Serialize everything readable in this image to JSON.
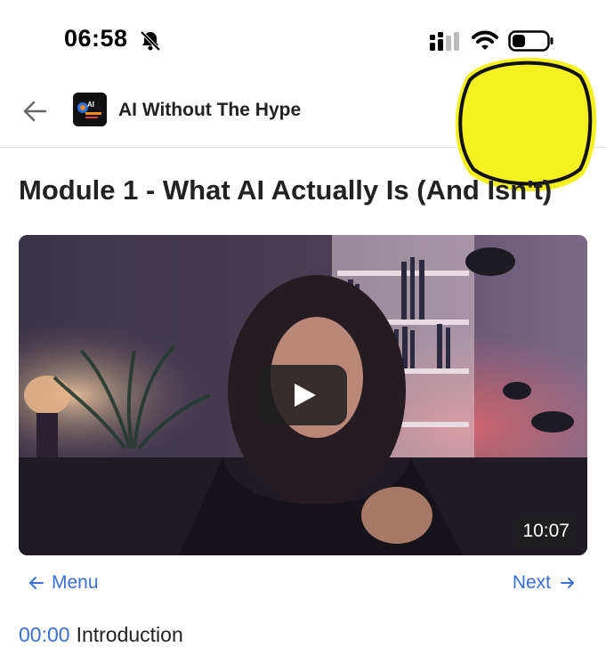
{
  "status_bar": {
    "time": "06:58",
    "icons": [
      "bell-slash-icon",
      "cellular-signal-icon",
      "wifi-icon",
      "battery-icon"
    ]
  },
  "header": {
    "title": "AI Without The Hype",
    "logo_text": "AI",
    "icons": [
      "arrow-left-icon",
      "check-circle-icon",
      "more-horizontal-icon"
    ]
  },
  "lesson": {
    "title": "Module 1 - What AI Actually Is (And Isn't)",
    "video": {
      "duration": "10:07",
      "play_icon": "play-icon"
    }
  },
  "navigation": {
    "menu_label": "Menu",
    "next_label": "Next"
  },
  "chapters": [
    {
      "timestamp": "00:00",
      "title": "Introduction"
    }
  ],
  "colors": {
    "accent": "#3a6fd8",
    "highlight": "#f5f020",
    "text": "#222222"
  }
}
